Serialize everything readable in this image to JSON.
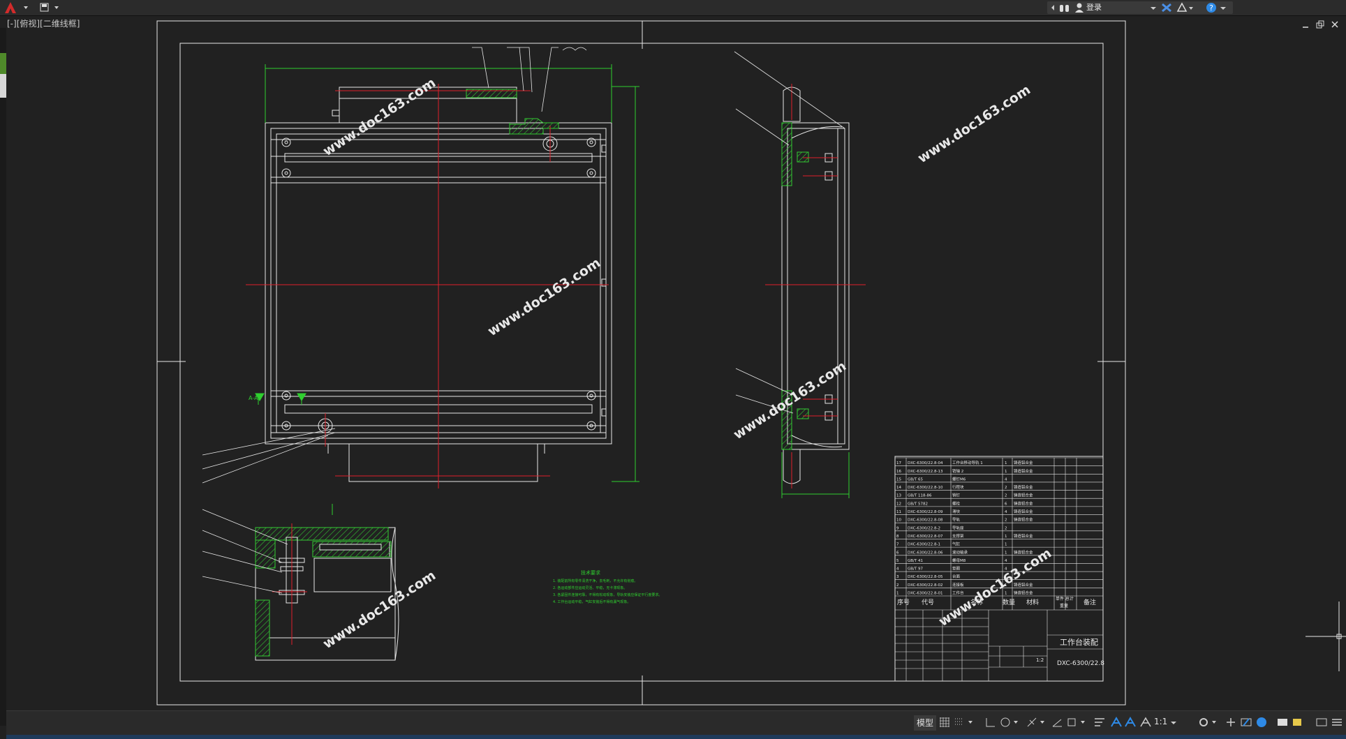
{
  "app": {
    "login_label": "登录",
    "view_label": "[-][俯视][二维线框]"
  },
  "watermark": "www.doc163.com",
  "drawing": {
    "title_block": {
      "drawing_title": "工作台装配",
      "drawing_number": "DXC-6300/22.8",
      "scale": "1:2",
      "header": {
        "seq": "序号",
        "code": "代号",
        "name": "名称",
        "qty": "数量",
        "material": "材料",
        "unit_total": "单件 总计",
        "weight": "重量",
        "remark": "备注"
      },
      "rows": [
        {
          "no": "17",
          "code": "DXC-6300/22.8-04",
          "name": "工作台移动导轨 1",
          "qty": "1",
          "material": "铸造铝合金"
        },
        {
          "no": "16",
          "code": "DXC-6300/22.8-13",
          "name": "销轴 2",
          "qty": "1",
          "material": "铸造铝合金"
        },
        {
          "no": "15",
          "code": "GB/T 65",
          "name": "螺钉M6",
          "qty": "4",
          "material": ""
        },
        {
          "no": "14",
          "code": "DXC-6300/22.8-10",
          "name": "行程块",
          "qty": "2",
          "material": "铸造铝合金"
        },
        {
          "no": "13",
          "code": "GB/T 118-86",
          "name": "销钉",
          "qty": "2",
          "material": "铸造铝合金"
        },
        {
          "no": "12",
          "code": "GB/T 5782",
          "name": "螺栓",
          "qty": "6",
          "material": "铸造铝合金"
        },
        {
          "no": "11",
          "code": "DXC-6300/22.8-09",
          "name": "滑块",
          "qty": "4",
          "material": "铸造铝合金"
        },
        {
          "no": "10",
          "code": "DXC-6300/22.8-08",
          "name": "导轨",
          "qty": "2",
          "material": "铸造铝合金"
        },
        {
          "no": "9",
          "code": "DXC-6300/22.8-2",
          "name": "导轨座",
          "qty": "2",
          "material": ""
        },
        {
          "no": "8",
          "code": "DXC-6300/22.8-07",
          "name": "支撑架",
          "qty": "1",
          "material": "铸造铝合金"
        },
        {
          "no": "7",
          "code": "DXC-6300/22.8-1",
          "name": "气缸",
          "qty": "1",
          "material": ""
        },
        {
          "no": "6",
          "code": "DXC-6300/22.8-06",
          "name": "滚动轴承",
          "qty": "1",
          "material": "铸造铝合金"
        },
        {
          "no": "5",
          "code": "GB/T 41",
          "name": "螺母M8",
          "qty": "4",
          "material": ""
        },
        {
          "no": "4",
          "code": "GB/T 97",
          "name": "垫圈",
          "qty": "4",
          "material": ""
        },
        {
          "no": "3",
          "code": "DXC-6300/22.8-05",
          "name": "台面",
          "qty": "1",
          "material": ""
        },
        {
          "no": "2",
          "code": "DXC-6300/22.8-02",
          "name": "连接板",
          "qty": "1",
          "material": "铸造铝合金"
        },
        {
          "no": "1",
          "code": "DXC-6300/22.8-01",
          "name": "工作台",
          "qty": "1",
          "material": "铸造铝合金"
        }
      ]
    },
    "tech_notes": {
      "heading": "技术要求",
      "lines": [
        "1. 装配前所有零件清洗干净，去毛刺，不允许有划痕。",
        "2. 各运动部件应运动灵活、平稳，无卡滞现象。",
        "3. 各紧固件连接可靠，不得有松动现象，导轨安装应保证平行度要求。",
        "4. 工作台运动平稳，气缸安装后不得有漏气现象。"
      ]
    },
    "section_label": "A-A"
  },
  "statusbar": {
    "model_label": "模型",
    "scale_label": "1:1"
  },
  "colors": {
    "background": "#212121",
    "line": "#e8e8e8",
    "center_line": "#e0202a",
    "dimension": "#2fd02f",
    "hatch": "#33cc33",
    "accent_blue": "#2e8ae6"
  }
}
